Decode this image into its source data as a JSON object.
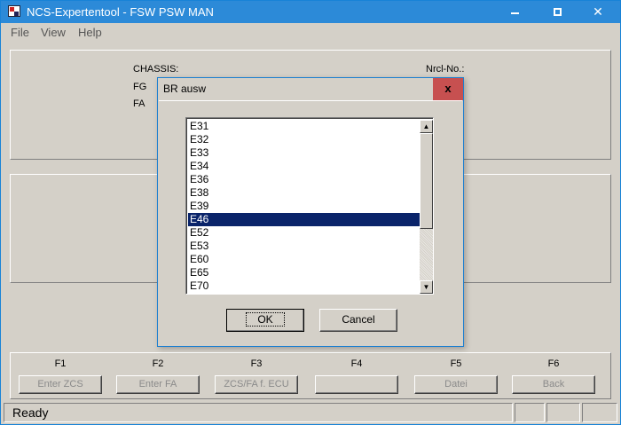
{
  "window": {
    "title": "NCS-Expertentool - FSW PSW MAN",
    "accent_color": "#2c8ad8"
  },
  "titlebar_buttons": {
    "minimize_icon": "minimize-icon",
    "maximize_icon": "maximize-icon",
    "close_symbol": "✕"
  },
  "menu": [
    "File",
    "View",
    "Help"
  ],
  "info": {
    "chassis_label": "CHASSIS:",
    "fg_label": "FG",
    "fa_label": "FA",
    "nrcl_label": "Nrcl-No.:"
  },
  "fkeys": [
    {
      "key": "F1",
      "label": "Enter ZCS"
    },
    {
      "key": "F2",
      "label": "Enter FA"
    },
    {
      "key": "F3",
      "label": "ZCS/FA f. ECU"
    },
    {
      "key": "F4",
      "label": ""
    },
    {
      "key": "F5",
      "label": "Datei"
    },
    {
      "key": "F6",
      "label": "Back"
    }
  ],
  "status": {
    "text": "Ready"
  },
  "dialog": {
    "title": "BR ausw",
    "close_symbol": "x",
    "items": [
      "E31",
      "E32",
      "E33",
      "E34",
      "E36",
      "E38",
      "E39",
      "E46",
      "E52",
      "E53",
      "E60",
      "E65",
      "E70"
    ],
    "selected": "E46",
    "ok_label": "OK",
    "cancel_label": "Cancel",
    "selection_color": "#0a246a",
    "close_color": "#c75050"
  }
}
